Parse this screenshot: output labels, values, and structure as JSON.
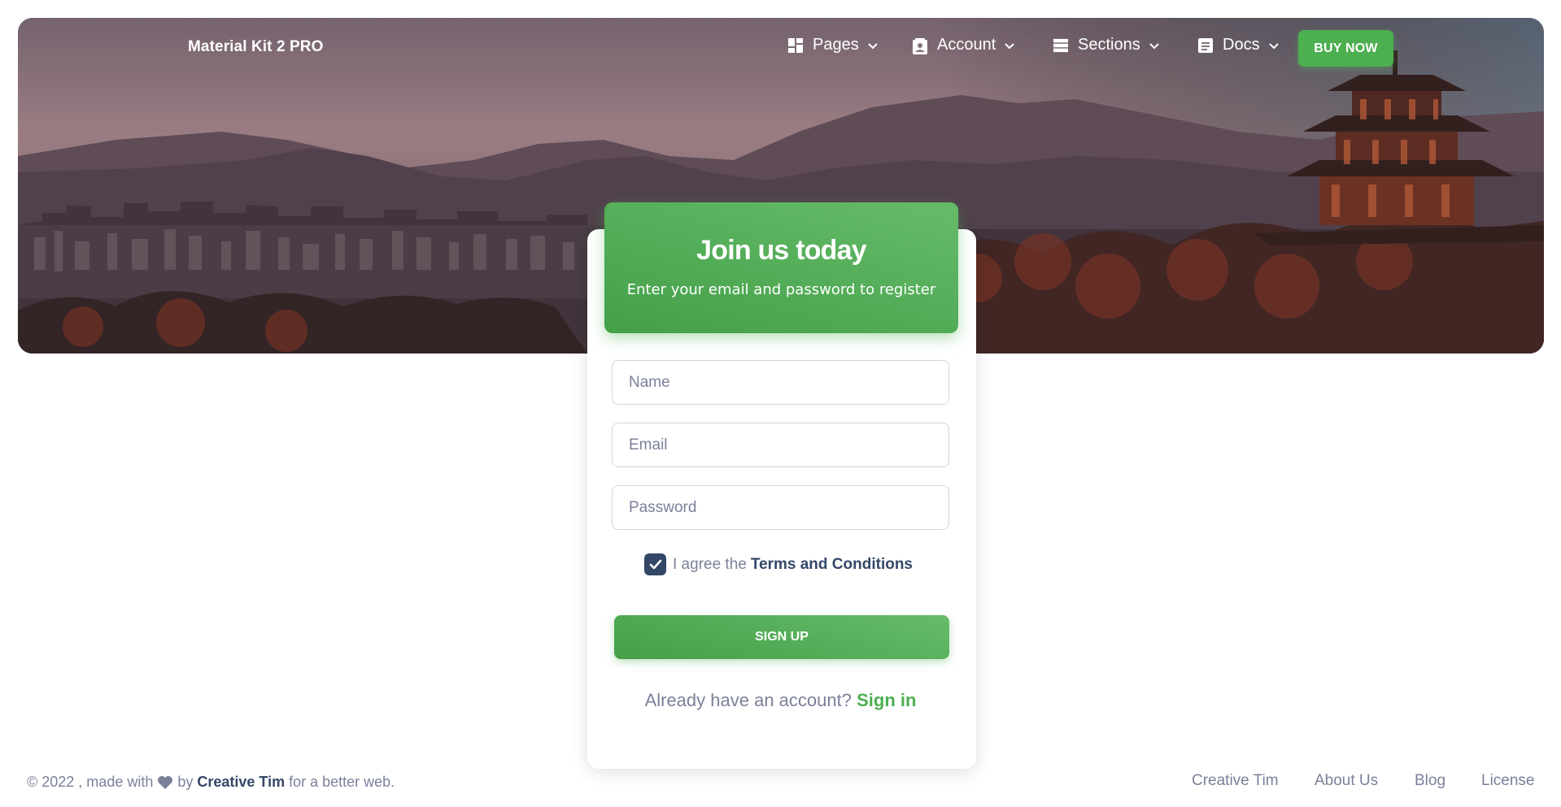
{
  "navbar": {
    "brand": "Material Kit 2 PRO",
    "items": [
      {
        "label": "Pages",
        "icon": "dashboard-icon"
      },
      {
        "label": "Account",
        "icon": "contact-card-icon"
      },
      {
        "label": "Sections",
        "icon": "view-list-icon"
      },
      {
        "label": "Docs",
        "icon": "article-icon"
      }
    ],
    "cta_label": "BUY NOW"
  },
  "card": {
    "title": "Join us today",
    "subtitle": "Enter your email and password to register",
    "fields": {
      "name_placeholder": "Name",
      "email_placeholder": "Email",
      "password_placeholder": "Password"
    },
    "agree_text": "I agree the",
    "terms_link": "Terms and Conditions",
    "agree_checked": true,
    "signup_label": "SIGN UP",
    "already_text": "Already have an account?",
    "signin_link": "Sign in"
  },
  "footer": {
    "copyright": "© 2022 , made with",
    "by": "by",
    "author": "Creative Tim",
    "tail": "for a better web.",
    "links": [
      "Creative Tim",
      "About Us",
      "Blog",
      "License"
    ]
  },
  "colors": {
    "accent_green": "#4caf50",
    "dark_text": "#344767",
    "muted_text": "#7b809a"
  }
}
